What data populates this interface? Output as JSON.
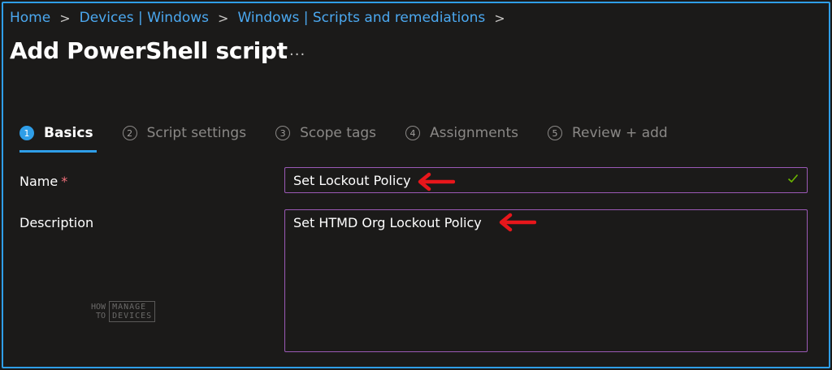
{
  "breadcrumb": {
    "items": [
      "Home",
      "Devices | Windows",
      "Windows | Scripts and remediations"
    ],
    "separator": ">"
  },
  "header": {
    "title": "Add PowerShell script",
    "more_label": "..."
  },
  "steps": [
    {
      "number": "1",
      "label": "Basics",
      "active": true
    },
    {
      "number": "2",
      "label": "Script settings",
      "active": false
    },
    {
      "number": "3",
      "label": "Scope tags",
      "active": false
    },
    {
      "number": "4",
      "label": "Assignments",
      "active": false
    },
    {
      "number": "5",
      "label": "Review + add",
      "active": false
    }
  ],
  "form": {
    "name_label": "Name",
    "required_mark": "*",
    "name_value": "Set Lockout Policy",
    "description_label": "Description",
    "description_value": "Set HTMD Org Lockout Policy"
  },
  "watermark": {
    "how": "HOW",
    "to": "TO",
    "manage": "MANAGE",
    "devices": "DEVICES"
  },
  "colors": {
    "accent": "#2f9ee8",
    "background": "#1b1a19",
    "input_border": "#9b59b6",
    "annotation_arrow": "#e8161b",
    "valid_check": "#6bb700"
  },
  "icons": {
    "valid": "check-icon",
    "annotation": "red-arrow-icon"
  }
}
